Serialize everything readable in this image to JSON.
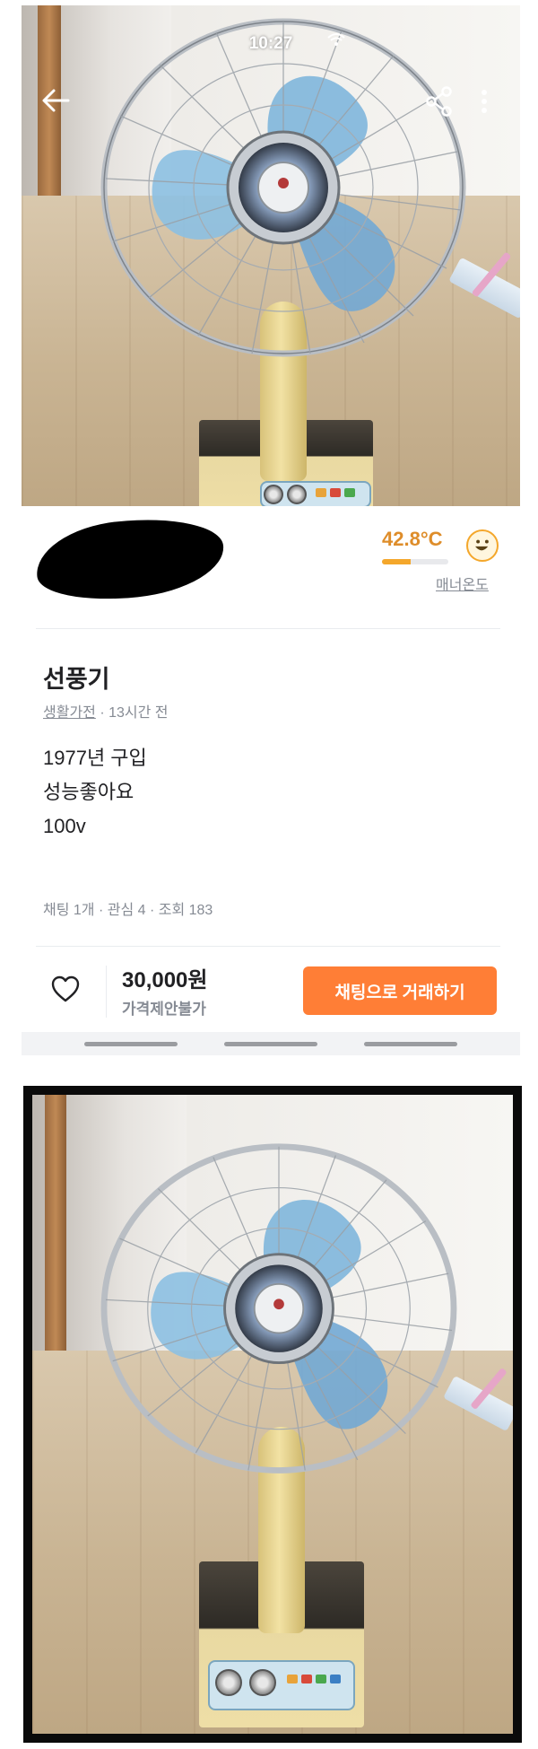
{
  "status_bar": {
    "time": "10:27"
  },
  "header_icons": {
    "back": "back-arrow-icon",
    "share": "share-icon",
    "more": "more-vertical-icon",
    "wifi": "wifi-icon"
  },
  "seller": {
    "manner_temp": "42.8°C",
    "manner_temp_value": 42.8,
    "manner_label": "매너온도",
    "manner_face": "smile-face-icon"
  },
  "article": {
    "title": "선풍기",
    "category": "생활가전",
    "time_ago": "· 13시간 전",
    "description": [
      "1977년 구입",
      "성능좋아요",
      "100v"
    ],
    "stats": "채팅 1개 · 관심 4 · 조회 183"
  },
  "bottom_bar": {
    "like_icon": "heart-outline-icon",
    "price": "30,000원",
    "negotiation": "가격제안불가",
    "chat_button": "채팅으로 거래하기"
  },
  "colors": {
    "accent": "#ff7e36",
    "manner": "#de8d2a",
    "text": "#212124",
    "muted": "#868b94"
  }
}
